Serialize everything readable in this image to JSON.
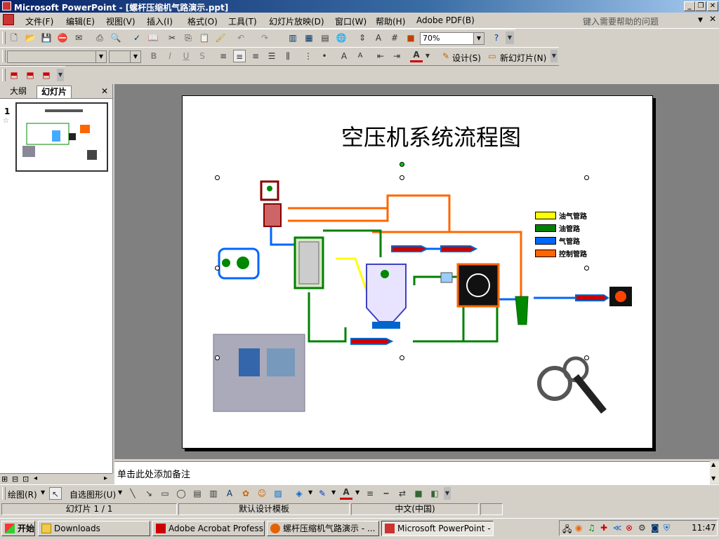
{
  "window": {
    "title": "Microsoft PowerPoint - [螺杆压缩机气路演示.ppt]"
  },
  "menu": {
    "items": [
      "文件(F)",
      "编辑(E)",
      "视图(V)",
      "插入(I)",
      "格式(O)",
      "工具(T)",
      "幻灯片放映(D)",
      "窗口(W)",
      "帮助(H)",
      "Adobe PDF(B)"
    ],
    "help_placeholder": "键入需要帮助的问题"
  },
  "toolbar": {
    "zoom": "70%",
    "design_label": "设计(S)",
    "new_slide_label": "新幻灯片(N)"
  },
  "leftpane": {
    "tabs": [
      "大纲",
      "幻灯片"
    ],
    "active_tab": "幻灯片",
    "slide_number": "1"
  },
  "slide": {
    "title": "空压机系统流程图",
    "legend": [
      "油气管路",
      "油管路",
      "气管路",
      "控制管路"
    ],
    "legend_colors": [
      "#ffff00",
      "#008000",
      "#0066ff",
      "#ff6600"
    ]
  },
  "notes": {
    "placeholder": "单击此处添加备注"
  },
  "drawing_toolbar": {
    "draw_label": "绘图(R)",
    "autoshapes_label": "自选图形(U)"
  },
  "status": {
    "slide": "幻灯片 1 / 1",
    "template": "默认设计模板",
    "language": "中文(中国)"
  },
  "taskbar": {
    "start": "开始",
    "buttons": [
      "Downloads",
      "Adobe Acrobat Professio...",
      "螺杆压缩机气路演示 - ...",
      "Microsoft PowerPoint - [..."
    ],
    "clock": "11:47"
  }
}
